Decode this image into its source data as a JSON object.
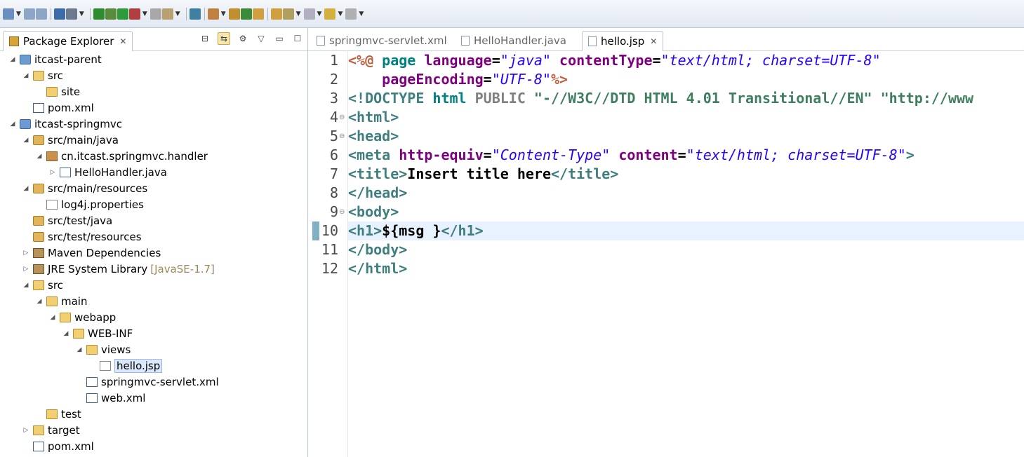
{
  "colors": {
    "accent": "#3f7f7f",
    "selection": "#dbe8fb",
    "current_line": "#e8f2fe",
    "string": "#2a00ff",
    "attribute": "#7f007f"
  },
  "toolbar": {
    "icons": [
      "new-icon",
      "save-icon",
      "save-all-icon",
      "console-icon",
      "skip-breakpoints-icon",
      "terminate-icon",
      "debug-icon",
      "run-icon",
      "external-tools-icon",
      "coverage-icon",
      "build-icon",
      "search-icon",
      "new-project-icon",
      "new-package-icon",
      "new-class-icon",
      "open-type-icon",
      "open-folder-icon",
      "prev-annotation-icon",
      "next-annotation-icon",
      "back-icon",
      "forward-icon"
    ]
  },
  "package_explorer": {
    "title": "Package Explorer",
    "tree": [
      {
        "label": "itcast-parent",
        "level": 0,
        "twisty": "open",
        "icon": "project-icon"
      },
      {
        "label": "src",
        "level": 1,
        "twisty": "open",
        "icon": "folder-icon"
      },
      {
        "label": "site",
        "level": 2,
        "twisty": "",
        "icon": "folder-icon"
      },
      {
        "label": "pom.xml",
        "level": 1,
        "twisty": "",
        "icon": "pom-icon"
      },
      {
        "label": "itcast-springmvc",
        "level": 0,
        "twisty": "open",
        "icon": "project-icon"
      },
      {
        "label": "src/main/java",
        "level": 1,
        "twisty": "open",
        "icon": "source-folder-icon"
      },
      {
        "label": "cn.itcast.springmvc.handler",
        "level": 2,
        "twisty": "open",
        "icon": "package-icon"
      },
      {
        "label": "HelloHandler.java",
        "level": 3,
        "twisty": "closed",
        "icon": "java-file-icon"
      },
      {
        "label": "src/main/resources",
        "level": 1,
        "twisty": "open",
        "icon": "source-folder-icon"
      },
      {
        "label": "log4j.properties",
        "level": 2,
        "twisty": "",
        "icon": "file-icon"
      },
      {
        "label": "src/test/java",
        "level": 1,
        "twisty": "",
        "icon": "source-folder-icon"
      },
      {
        "label": "src/test/resources",
        "level": 1,
        "twisty": "",
        "icon": "source-folder-icon"
      },
      {
        "label": "Maven Dependencies",
        "level": 1,
        "twisty": "closed",
        "icon": "library-icon"
      },
      {
        "label": "JRE System Library",
        "level": 1,
        "twisty": "closed",
        "icon": "library-icon",
        "suffix": "[JavaSE-1.7]"
      },
      {
        "label": "src",
        "level": 1,
        "twisty": "open",
        "icon": "folder-icon"
      },
      {
        "label": "main",
        "level": 2,
        "twisty": "open",
        "icon": "folder-icon"
      },
      {
        "label": "webapp",
        "level": 3,
        "twisty": "open",
        "icon": "folder-icon"
      },
      {
        "label": "WEB-INF",
        "level": 4,
        "twisty": "open",
        "icon": "folder-icon"
      },
      {
        "label": "views",
        "level": 5,
        "twisty": "open",
        "icon": "folder-icon"
      },
      {
        "label": "hello.jsp",
        "level": 6,
        "twisty": "",
        "icon": "file-icon",
        "selected": true
      },
      {
        "label": "springmvc-servlet.xml",
        "level": 5,
        "twisty": "",
        "icon": "xml-file-icon"
      },
      {
        "label": "web.xml",
        "level": 5,
        "twisty": "",
        "icon": "xml-file-icon"
      },
      {
        "label": "test",
        "level": 2,
        "twisty": "",
        "icon": "folder-icon"
      },
      {
        "label": "target",
        "level": 1,
        "twisty": "closed",
        "icon": "folder-icon"
      },
      {
        "label": "pom.xml",
        "level": 1,
        "twisty": "",
        "icon": "pom-icon"
      }
    ]
  },
  "editor": {
    "tabs": [
      {
        "label": "springmvc-servlet.xml",
        "active": false
      },
      {
        "label": "HelloHandler.java",
        "active": false
      },
      {
        "label": "hello.jsp",
        "active": true
      }
    ],
    "line_numbers": [
      "1",
      "2",
      "3",
      "4",
      "5",
      "6",
      "7",
      "8",
      "9",
      "10",
      "11",
      "12"
    ],
    "lines": [
      [
        [
          "<%@",
          "delim"
        ],
        [
          " page ",
          "kw"
        ],
        [
          "language",
          "attr"
        ],
        [
          "=",
          "txt"
        ],
        [
          "\"java\"",
          "str"
        ],
        [
          " contentType",
          "attr"
        ],
        [
          "=",
          "txt"
        ],
        [
          "\"text/html; charset=UTF-8\"",
          "str"
        ]
      ],
      [
        [
          "    pageEncoding",
          "attr"
        ],
        [
          "=",
          "txt"
        ],
        [
          "\"UTF-8\"",
          "str"
        ],
        [
          "%>",
          "delim"
        ]
      ],
      [
        [
          "<!DOCTYPE",
          "dt"
        ],
        [
          " html",
          "kw"
        ],
        [
          " PUBLIC",
          "pub"
        ],
        [
          " \"-//W3C//DTD HTML 4.01 Transitional//EN\"",
          "doc"
        ],
        [
          " \"http://www",
          "doc"
        ]
      ],
      [
        [
          "<html>",
          "tag"
        ]
      ],
      [
        [
          "<head>",
          "tag"
        ]
      ],
      [
        [
          "<meta",
          "tag"
        ],
        [
          " http-equiv",
          "attr"
        ],
        [
          "=",
          "txt"
        ],
        [
          "\"Content-Type\"",
          "str"
        ],
        [
          " content",
          "attr"
        ],
        [
          "=",
          "txt"
        ],
        [
          "\"text/html; charset=UTF-8\"",
          "str"
        ],
        [
          ">",
          "tag"
        ]
      ],
      [
        [
          "<title>",
          "tag"
        ],
        [
          "Insert title here",
          "txt"
        ],
        [
          "</title>",
          "tag"
        ]
      ],
      [
        [
          "</head>",
          "tag"
        ]
      ],
      [
        [
          "<body>",
          "tag"
        ]
      ],
      [
        [
          "<h1>",
          "tag"
        ],
        [
          "${msg }",
          "txt"
        ],
        [
          "</h1>",
          "tag"
        ]
      ],
      [
        [
          "</body>",
          "tag"
        ]
      ],
      [
        [
          "</html>",
          "tag"
        ]
      ]
    ],
    "folds": [
      "",
      "",
      "",
      "⊖",
      "⊖",
      "",
      "",
      "",
      "⊖",
      "",
      "",
      ""
    ]
  }
}
